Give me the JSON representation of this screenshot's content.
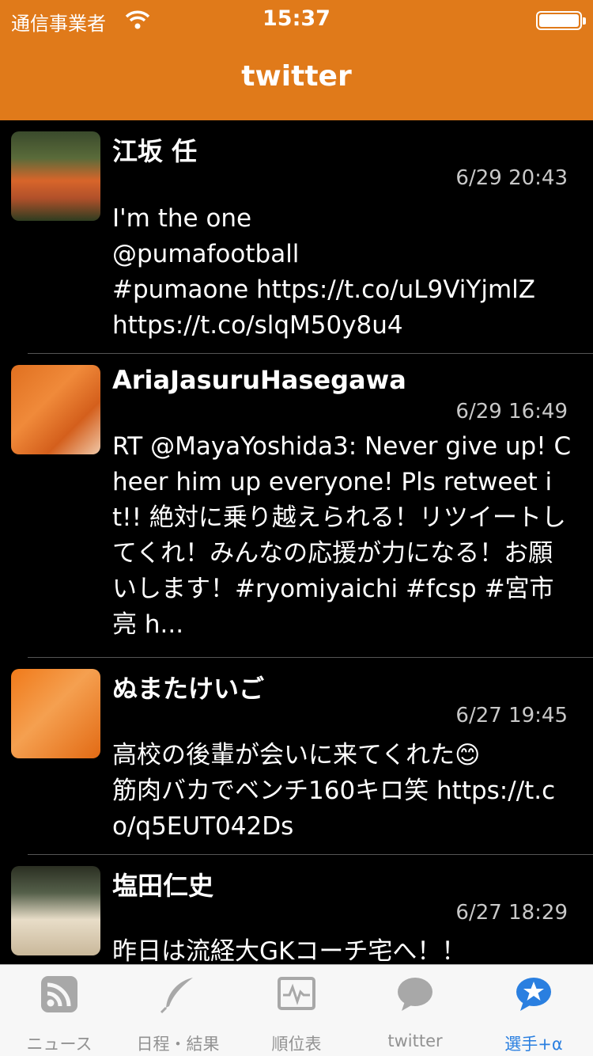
{
  "status_bar": {
    "carrier": "通信事業者",
    "time": "15:37"
  },
  "nav": {
    "title": "twitter"
  },
  "tweets": [
    {
      "name": "江坂 任",
      "time": "6/29 20:43",
      "text": "I'm the one\n@pumafootball\n#pumaone https://t.co/uL9ViYjmlZ\nhttps://t.co/slqM50y8u4"
    },
    {
      "name": "AriaJasuruHasegawa",
      "time": "6/29 16:49",
      "text": "RT @MayaYoshida3: Never give up! Cheer him up everyone! Pls retweet it!! 絶対に乗り越えられる！リツイートしてくれ！みんなの応援が力になる！お願いします！#ryomiyaichi #fcsp #宮市亮 h..."
    },
    {
      "name": "ぬまたけいご",
      "time": "6/27 19:45",
      "text": "高校の後輩が会いに来てくれた😊\n筋肉バカでベンチ160キロ笑 https://t.co/q5EUT042Ds"
    },
    {
      "name": "塩田仁史",
      "time": "6/27 18:29",
      "text": "昨日は流経大GKコーチ宅へ！！"
    }
  ],
  "tabs": [
    {
      "label": "ニュース",
      "icon": "rss-icon",
      "active": false
    },
    {
      "label": "日程・結果",
      "icon": "feather-icon",
      "active": false
    },
    {
      "label": "順位表",
      "icon": "monitor-icon",
      "active": false
    },
    {
      "label": "twitter",
      "icon": "speech-bubble-icon",
      "active": false
    },
    {
      "label": "選手+α",
      "icon": "star-bubble-icon",
      "active": true
    }
  ],
  "colors": {
    "accent": "#e07a1a",
    "tab_active": "#2a7fe0",
    "tab_inactive": "#929292"
  }
}
